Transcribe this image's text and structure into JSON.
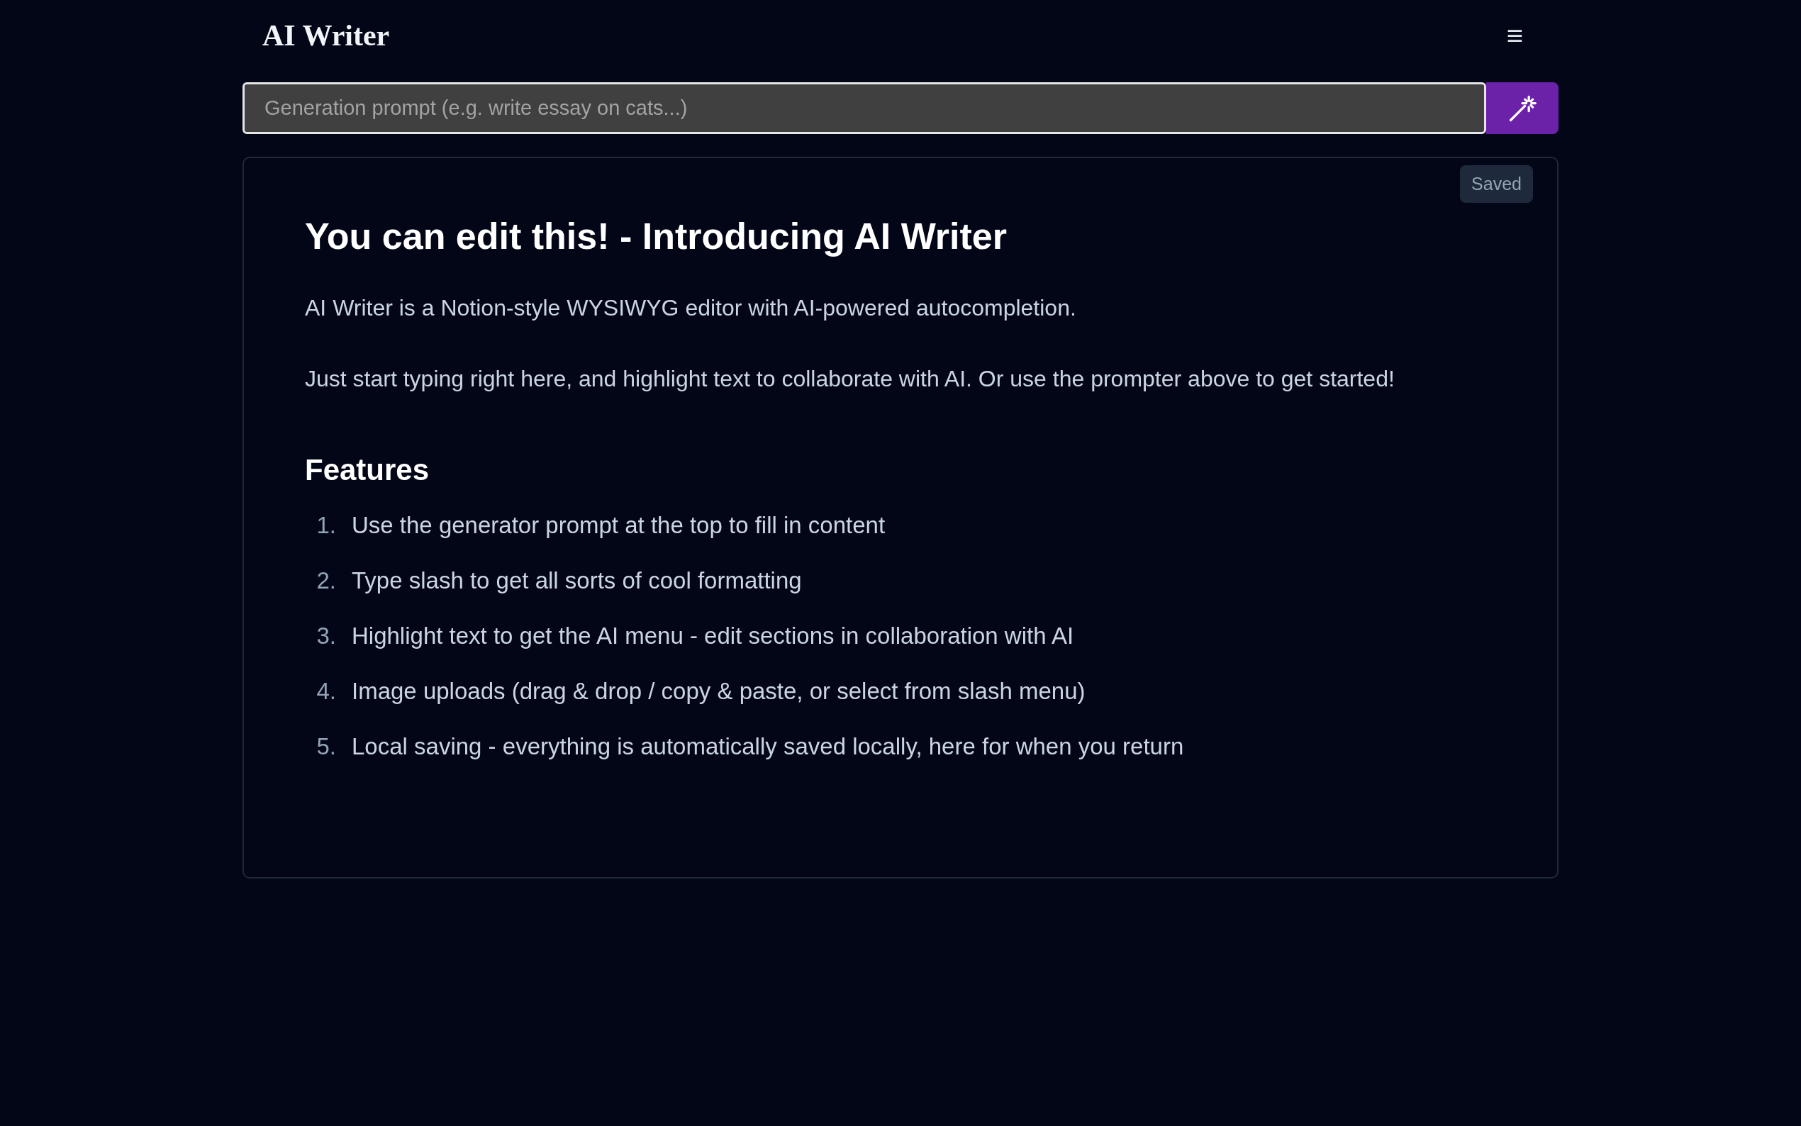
{
  "header": {
    "title": "AI Writer",
    "menu_icon": "≡"
  },
  "prompt": {
    "placeholder": "Generation prompt (e.g. write essay on cats...)"
  },
  "editor": {
    "status": "Saved",
    "title": "You can edit this! - Introducing AI Writer",
    "paragraphs": [
      "AI Writer is a Notion-style WYSIWYG editor with AI-powered autocompletion.",
      "Just start typing right here, and highlight text to collaborate with AI. Or use the prompter above to get started!"
    ],
    "section_heading": "Features",
    "features": [
      {
        "number": "1.",
        "text": "Use the generator prompt at the top to fill in content"
      },
      {
        "number": "2.",
        "text": "Type slash to get all sorts of cool formatting"
      },
      {
        "number": "3.",
        "text": "Highlight text to get the AI menu - edit sections in collaboration with AI"
      },
      {
        "number": "4.",
        "text": "Image uploads (drag & drop / copy & paste, or select from slash menu)"
      },
      {
        "number": "5.",
        "text": "Local saving - everything is automatically saved locally, here for when you return"
      }
    ]
  }
}
